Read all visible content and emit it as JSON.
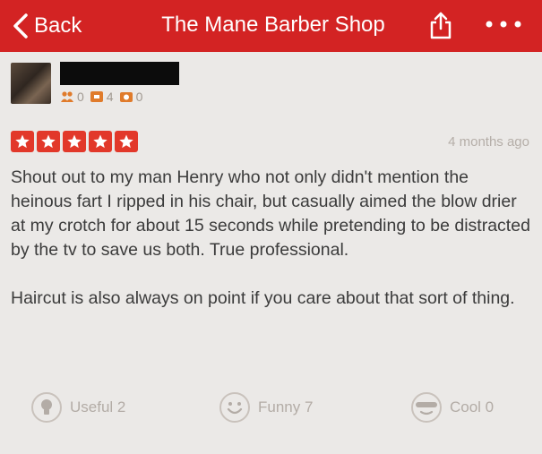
{
  "navbar": {
    "back_label": "Back",
    "title": "The Mane Barber Shop",
    "share_icon": "share-icon",
    "more_icon": "more-icon",
    "color": "#d32323"
  },
  "reviewer": {
    "friends_count": "0",
    "reviews_count": "4",
    "photos_count": "0"
  },
  "review": {
    "rating": 5,
    "rating_color": "#e2382a",
    "time": "4 months ago",
    "paragraphs": [
      "Shout out to my man Henry who not only didn't mention the heinous fart I ripped in his chair, but casually aimed the blow drier at my crotch for about 15 seconds while pretending to be distracted by the tv to save us both. True professional.",
      "Haircut is also always on point if you care about that sort of thing."
    ]
  },
  "actions": {
    "useful_label": "Useful 2",
    "funny_label": "Funny 7",
    "cool_label": "Cool 0"
  }
}
